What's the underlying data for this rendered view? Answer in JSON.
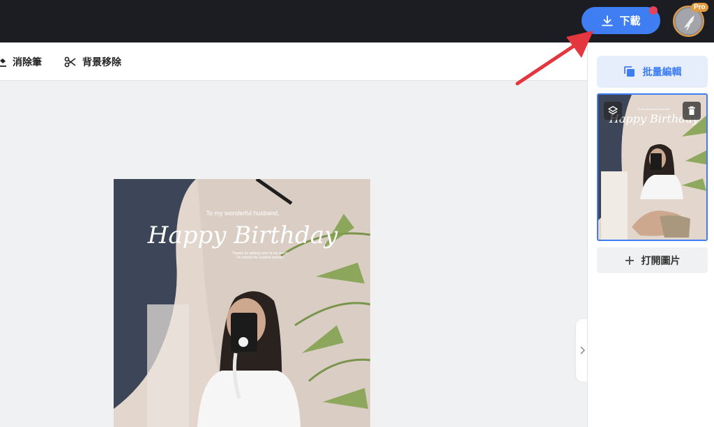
{
  "header": {
    "download_label": "下載",
    "pro_badge": "Pro"
  },
  "toolbar": {
    "eraser_label": "消除筆",
    "bg_remove_label": "背景移除"
  },
  "side_panel": {
    "batch_edit_label": "批量編輯",
    "open_image_label": "打開圖片"
  },
  "photo": {
    "line1": "To my wonderful husband,",
    "title": "Happy Birthday",
    "line3": "Thanks for adding color to my world.",
    "line4": "I'm indeed the luckiest woman!"
  },
  "colors": {
    "accent": "#3f7df3",
    "topbar": "#1c1d22",
    "annotation_arrow": "#e3363e",
    "pro": "#e39a3e"
  }
}
